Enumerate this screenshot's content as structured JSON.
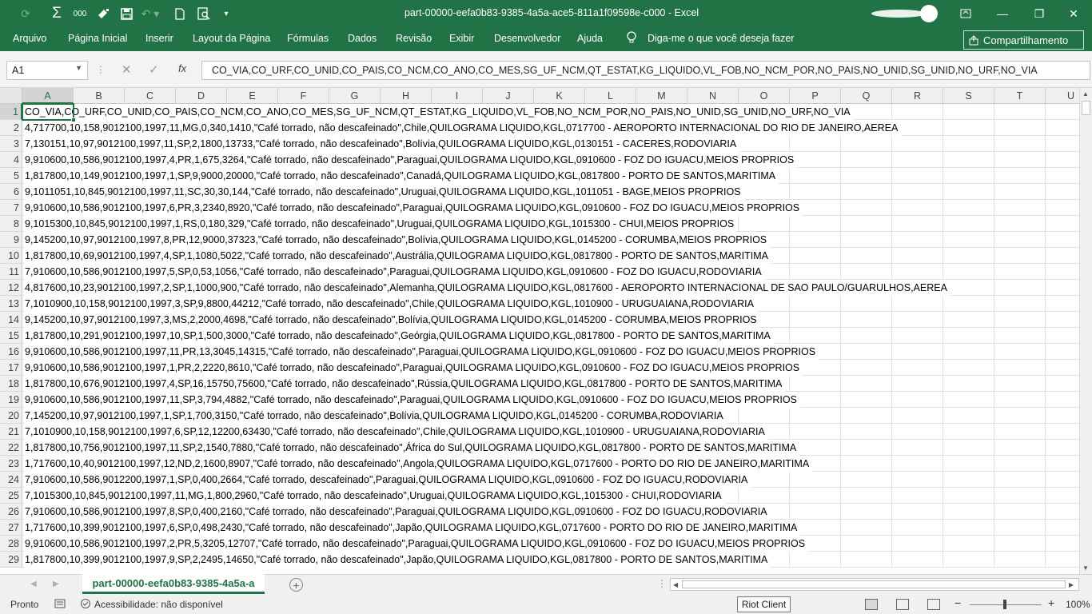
{
  "titlebar": {
    "title": "part-00000-eefa0b83-9385-4a5a-ace5-811a1f09598e-c000  -  Excel",
    "quick_access": {
      "autosum_icon": "Σ",
      "format_number": "000",
      "save_icon": "save",
      "customize_icon": "▾"
    },
    "window_buttons": {
      "ribbon_options": "ribbon-display-icon",
      "minimize": "—",
      "restore": "❐",
      "close": "✕"
    }
  },
  "ribbon": {
    "tabs": [
      "Arquivo",
      "Página Inicial",
      "Inserir",
      "Layout da Página",
      "Fórmulas",
      "Dados",
      "Revisão",
      "Exibir",
      "Desenvolvedor",
      "Ajuda"
    ],
    "tell_me": "Diga-me o que você deseja fazer",
    "share": "Compartilhamento"
  },
  "formula_bar": {
    "name_box": "A1",
    "fx": "fx",
    "content": "CO_VIA,CO_URF,CO_UNID,CO_PAIS,CO_NCM,CO_ANO,CO_MES,SG_UF_NCM,QT_ESTAT,KG_LIQUIDO,VL_FOB,NO_NCM_POR,NO_PAIS,NO_UNID,SG_UNID,NO_URF,NO_VIA"
  },
  "sheet": {
    "columns": [
      "A",
      "B",
      "C",
      "D",
      "E",
      "F",
      "G",
      "H",
      "I",
      "J",
      "K",
      "L",
      "M",
      "N",
      "O",
      "P",
      "Q",
      "R",
      "S",
      "T",
      "U"
    ],
    "selected_cell": "A1",
    "rows": [
      {
        "n": "1",
        "text": "CO_VIA,CO_URF,CO_UNID,CO_PAIS,CO_NCM,CO_ANO,CO_MES,SG_UF_NCM,QT_ESTAT,KG_LIQUIDO,VL_FOB,NO_NCM_POR,NO_PAIS,NO_UNID,SG_UNID,NO_URF,NO_VIA"
      },
      {
        "n": "2",
        "text": "4,717700,10,158,9012100,1997,11,MG,0,340,1410,\"Café torrado, não descafeinado\",Chile,QUILOGRAMA LIQUIDO,KGL,0717700 - AEROPORTO INTERNACIONAL DO RIO DE JANEIRO,AEREA"
      },
      {
        "n": "3",
        "text": "7,130151,10,97,9012100,1997,11,SP,2,1800,13733,\"Café torrado, não descafeinado\",Bolívia,QUILOGRAMA LIQUIDO,KGL,0130151 - CACERES,RODOVIARIA"
      },
      {
        "n": "4",
        "text": "9,910600,10,586,9012100,1997,4,PR,1,675,3264,\"Café torrado, não descafeinado\",Paraguai,QUILOGRAMA LIQUIDO,KGL,0910600 - FOZ DO IGUACU,MEIOS PROPRIOS"
      },
      {
        "n": "5",
        "text": "1,817800,10,149,9012100,1997,1,SP,9,9000,20000,\"Café torrado, não descafeinado\",Canadá,QUILOGRAMA LIQUIDO,KGL,0817800 - PORTO DE SANTOS,MARITIMA"
      },
      {
        "n": "6",
        "text": "9,1011051,10,845,9012100,1997,11,SC,30,30,144,\"Café torrado, não descafeinado\",Uruguai,QUILOGRAMA LIQUIDO,KGL,1011051 - BAGE,MEIOS PROPRIOS"
      },
      {
        "n": "7",
        "text": "9,910600,10,586,9012100,1997,6,PR,3,2340,8920,\"Café torrado, não descafeinado\",Paraguai,QUILOGRAMA LIQUIDO,KGL,0910600 - FOZ DO IGUACU,MEIOS PROPRIOS"
      },
      {
        "n": "8",
        "text": "9,1015300,10,845,9012100,1997,1,RS,0,180,329,\"Café torrado, não descafeinado\",Uruguai,QUILOGRAMA LIQUIDO,KGL,1015300 - CHUI,MEIOS PROPRIOS"
      },
      {
        "n": "9",
        "text": "9,145200,10,97,9012100,1997,8,PR,12,9000,37323,\"Café torrado, não descafeinado\",Bolívia,QUILOGRAMA LIQUIDO,KGL,0145200 - CORUMBA,MEIOS PROPRIOS"
      },
      {
        "n": "10",
        "text": "1,817800,10,69,9012100,1997,4,SP,1,1080,5022,\"Café torrado, não descafeinado\",Austrália,QUILOGRAMA LIQUIDO,KGL,0817800 - PORTO DE SANTOS,MARITIMA"
      },
      {
        "n": "11",
        "text": "7,910600,10,586,9012100,1997,5,SP,0,53,1056,\"Café torrado, não descafeinado\",Paraguai,QUILOGRAMA LIQUIDO,KGL,0910600 - FOZ DO IGUACU,RODOVIARIA"
      },
      {
        "n": "12",
        "text": "4,817600,10,23,9012100,1997,2,SP,1,1000,900,\"Café torrado, não descafeinado\",Alemanha,QUILOGRAMA LIQUIDO,KGL,0817600 - AEROPORTO INTERNACIONAL DE SAO PAULO/GUARULHOS,AEREA"
      },
      {
        "n": "13",
        "text": "7,1010900,10,158,9012100,1997,3,SP,9,8800,44212,\"Café torrado, não descafeinado\",Chile,QUILOGRAMA LIQUIDO,KGL,1010900 - URUGUAIANA,RODOVIARIA"
      },
      {
        "n": "14",
        "text": "9,145200,10,97,9012100,1997,3,MS,2,2000,4698,\"Café torrado, não descafeinado\",Bolívia,QUILOGRAMA LIQUIDO,KGL,0145200 - CORUMBA,MEIOS PROPRIOS"
      },
      {
        "n": "15",
        "text": "1,817800,10,291,9012100,1997,10,SP,1,500,3000,\"Café torrado, não descafeinado\",Geórgia,QUILOGRAMA LIQUIDO,KGL,0817800 - PORTO DE SANTOS,MARITIMA"
      },
      {
        "n": "16",
        "text": "9,910600,10,586,9012100,1997,11,PR,13,3045,14315,\"Café torrado, não descafeinado\",Paraguai,QUILOGRAMA LIQUIDO,KGL,0910600 - FOZ DO IGUACU,MEIOS PROPRIOS"
      },
      {
        "n": "17",
        "text": "9,910600,10,586,9012100,1997,1,PR,2,2220,8610,\"Café torrado, não descafeinado\",Paraguai,QUILOGRAMA LIQUIDO,KGL,0910600 - FOZ DO IGUACU,MEIOS PROPRIOS"
      },
      {
        "n": "18",
        "text": "1,817800,10,676,9012100,1997,4,SP,16,15750,75600,\"Café torrado, não descafeinado\",Rússia,QUILOGRAMA LIQUIDO,KGL,0817800 - PORTO DE SANTOS,MARITIMA"
      },
      {
        "n": "19",
        "text": "9,910600,10,586,9012100,1997,11,SP,3,794,4882,\"Café torrado, não descafeinado\",Paraguai,QUILOGRAMA LIQUIDO,KGL,0910600 - FOZ DO IGUACU,MEIOS PROPRIOS"
      },
      {
        "n": "20",
        "text": "7,145200,10,97,9012100,1997,1,SP,1,700,3150,\"Café torrado, não descafeinado\",Bolívia,QUILOGRAMA LIQUIDO,KGL,0145200 - CORUMBA,RODOVIARIA"
      },
      {
        "n": "21",
        "text": "7,1010900,10,158,9012100,1997,6,SP,12,12200,63430,\"Café torrado, não descafeinado\",Chile,QUILOGRAMA LIQUIDO,KGL,1010900 - URUGUAIANA,RODOVIARIA"
      },
      {
        "n": "22",
        "text": "1,817800,10,756,9012100,1997,11,SP,2,1540,7880,\"Café torrado, não descafeinado\",África do Sul,QUILOGRAMA LIQUIDO,KGL,0817800 - PORTO DE SANTOS,MARITIMA"
      },
      {
        "n": "23",
        "text": "1,717600,10,40,9012100,1997,12,ND,2,1600,8907,\"Café torrado, não descafeinado\",Angola,QUILOGRAMA LIQUIDO,KGL,0717600 - PORTO DO RIO DE JANEIRO,MARITIMA"
      },
      {
        "n": "24",
        "text": "7,910600,10,586,9012200,1997,1,SP,0,400,2664,\"Café torrado, descafeinado\",Paraguai,QUILOGRAMA LIQUIDO,KGL,0910600 - FOZ DO IGUACU,RODOVIARIA"
      },
      {
        "n": "25",
        "text": "7,1015300,10,845,9012100,1997,11,MG,1,800,2960,\"Café torrado, não descafeinado\",Uruguai,QUILOGRAMA LIQUIDO,KGL,1015300 - CHUI,RODOVIARIA"
      },
      {
        "n": "26",
        "text": "7,910600,10,586,9012100,1997,8,SP,0,400,2160,\"Café torrado, não descafeinado\",Paraguai,QUILOGRAMA LIQUIDO,KGL,0910600 - FOZ DO IGUACU,RODOVIARIA"
      },
      {
        "n": "27",
        "text": "1,717600,10,399,9012100,1997,6,SP,0,498,2430,\"Café torrado, não descafeinado\",Japão,QUILOGRAMA LIQUIDO,KGL,0717600 - PORTO DO RIO DE JANEIRO,MARITIMA"
      },
      {
        "n": "28",
        "text": "9,910600,10,586,9012100,1997,2,PR,5,3205,12707,\"Café torrado, não descafeinado\",Paraguai,QUILOGRAMA LIQUIDO,KGL,0910600 - FOZ DO IGUACU,MEIOS PROPRIOS"
      },
      {
        "n": "29",
        "text": "1,817800,10,399,9012100,1997,9,SP,2,2495,14650,\"Café torrado, não descafeinado\",Japão,QUILOGRAMA LIQUIDO,KGL,0817800 - PORTO DE SANTOS,MARITIMA"
      }
    ]
  },
  "sheet_tabs": {
    "active": "part-00000-eefa0b83-9385-4a5a-a",
    "add_label": "+"
  },
  "status_bar": {
    "ready": "Pronto",
    "accessibility": "Acessibilidade: não disponível",
    "tooltip": "Riot Client",
    "zoom": "100%",
    "zoom_minus": "−",
    "zoom_plus": "+"
  },
  "colors": {
    "excel_green": "#217346",
    "grid": "#e2e2e2",
    "header_bg": "#efefef"
  }
}
